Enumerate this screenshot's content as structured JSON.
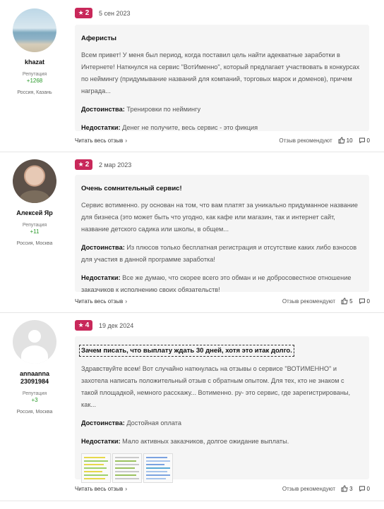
{
  "colors": {
    "badge": "#c8285a",
    "reputation": "#2b9a2b",
    "card_bg": "#f5f5f5"
  },
  "labels": {
    "reputation": "Репутация",
    "read_more": "Читать весь отзыв",
    "recommend": "Отзыв рекомендуют",
    "pros": "Достоинства:",
    "cons": "Недостатки:"
  },
  "reviews": [
    {
      "user": {
        "name": "khazat",
        "reputation": "+1268",
        "location": "Россия, Казань",
        "avatar": "beach-photo"
      },
      "rating": "2",
      "date": "5 сен 2023",
      "title": "Аферисты",
      "body": "Всем привет! У меня был период, когда поставил цель найти адекватные заработки в Интернете! Наткнулся на сервис \"ВотИменно\", который предлагает участвовать в конкурсах по неймингу (придумывание названий для компаний, торговых марок и доменов), причем награда...",
      "pros": "Тренировки по неймингу",
      "cons": "Денег не получите, весь сервис - это фикция",
      "likes": "10",
      "comments": "0"
    },
    {
      "user": {
        "name": "Алексей Яр",
        "reputation": "+11",
        "location": "Россия, Москва",
        "avatar": "man-photo"
      },
      "rating": "2",
      "date": "2 мар 2023",
      "title": "Очень сомнительный сервис!",
      "body": "Сервис вотименно. ру основан на том, что вам платят за уникально придуманное название для бизнеса (это может быть что угодно, как кафе или магазин, так и интернет сайт, название детского садика или школы, в общем...",
      "pros": "Из плюсов только бесплатная регистрация и отсутствие каких либо взносов для участия в данной программе заработка!",
      "cons": "Все же думаю, что скорее всего это обман и не добросовестное отношение заказчиков к исполнению своих обязательств!",
      "likes": "5",
      "comments": "0"
    },
    {
      "user": {
        "name": "annaanna 23091984",
        "reputation": "+3",
        "location": "Россия, Москва",
        "avatar": "default-avatar"
      },
      "rating": "4",
      "date": "19 дек 2024",
      "title": "Зачем писать, что выплату ждать 30 дней, хотя это итак долго.",
      "body": "Здравствуйте всем! Вот случайно наткнулась на отзывы о сервисе \"ВОТИМЕННО\" и захотела написать положительный отзыв с обратным опытом. Для тех, кто не знаком с такой площадкой, немного расскажу... Вотименно. ру- это сервис, где зарегистрированы, как...",
      "pros": "Достойная оплата",
      "cons": "Мало активных заказчиков, долгое ожидание выплаты.",
      "likes": "3",
      "comments": "0"
    }
  ]
}
